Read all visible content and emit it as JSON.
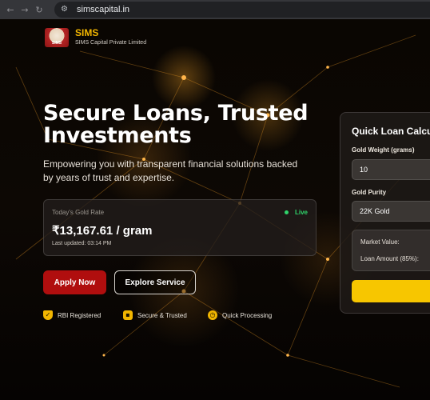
{
  "browser": {
    "url": "simscapital.in",
    "back_icon": "arrow-left-icon",
    "forward_icon": "arrow-right-icon",
    "reload_icon": "reload-icon",
    "site_icon": "site-settings-icon"
  },
  "brand": {
    "name": "SIMS",
    "subtitle": "SIMS Capital Private Limited",
    "logo_text": "SIMS"
  },
  "hero": {
    "headline": "Secure Loans, Trusted Investments",
    "subheadline": "Empowering you with transparent financial solutions backed by years of trust and expertise."
  },
  "gold_rate": {
    "label": "Today's Gold Rate",
    "status": "Live",
    "value": "₹13,167.61 / gram",
    "updated": "Last updated: 03:14 PM"
  },
  "actions": {
    "apply_label": "Apply Now",
    "explore_label": "Explore Service"
  },
  "features": [
    {
      "label": "RBI Registered",
      "icon": "shield-check-icon"
    },
    {
      "label": "Secure & Trusted",
      "icon": "lock-icon"
    },
    {
      "label": "Quick Processing",
      "icon": "clock-icon"
    }
  ],
  "calculator": {
    "title": "Quick Loan Calcu",
    "weight_label": "Gold Weight (grams)",
    "weight_value": "10",
    "purity_label": "Gold Purity",
    "purity_value": "22K Gold",
    "market_value_label": "Market Value:",
    "loan_amount_label": "Loan Amount (85%):"
  },
  "colors": {
    "accent_gold": "#f1b500",
    "primary_red": "#b00e0e",
    "live_green": "#2fd46b",
    "calc_button": "#f7c600"
  }
}
